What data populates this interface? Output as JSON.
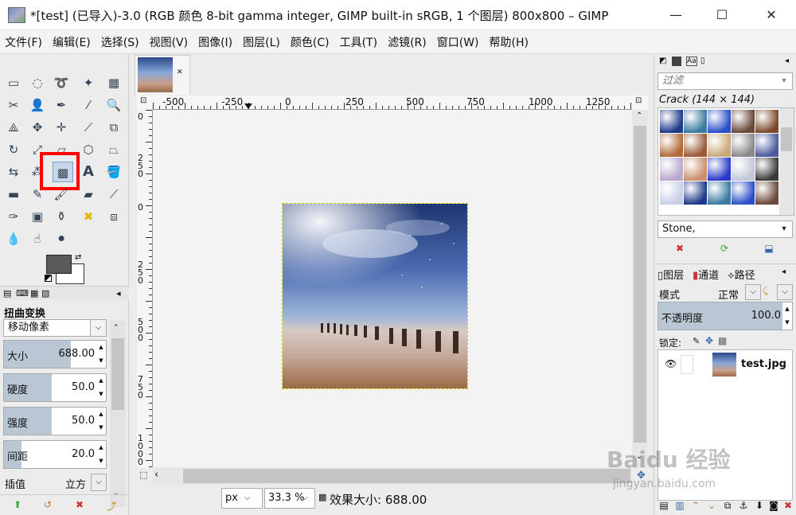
{
  "window": {
    "title": "*[test] (已导入)-3.0 (RGB 颜色 8-bit gamma integer, GIMP built-in sRGB, 1 个图层) 800x800 – GIMP",
    "minimize": "—",
    "maximize": "☐",
    "close": "✕"
  },
  "menu": [
    "文件(F)",
    "编辑(E)",
    "选择(S)",
    "视图(V)",
    "图像(I)",
    "图层(L)",
    "颜色(C)",
    "工具(T)",
    "滤镜(R)",
    "窗口(W)",
    "帮助(H)"
  ],
  "image_tab": {
    "close": "✕"
  },
  "ruler_h": [
    "-500",
    "-250",
    "0",
    "250",
    "500",
    "750",
    "1000",
    "1250"
  ],
  "ruler_v": [
    "0",
    "2\n5\n0",
    "0",
    "2\n5\n0",
    "5\n0\n0",
    "7\n5\n0",
    "1\n0\n0\n0"
  ],
  "tool_options": {
    "title": "扭曲变换",
    "mode": "移动像素",
    "size_label": "大小",
    "size_value": "688.00",
    "hardness_label": "硬度",
    "hardness_value": "50.0",
    "strength_label": "强度",
    "strength_value": "50.0",
    "spacing_label": "间距",
    "spacing_value": "20.0",
    "interp_label": "插值",
    "interp_value": "立方"
  },
  "status": {
    "unit": "px",
    "zoom": "33.3 %",
    "message": "效果大小: 688.00"
  },
  "patterns": {
    "filter_placeholder": "过滤",
    "current": "Crack (144 × 144)",
    "tag": "Stone,"
  },
  "layers": {
    "tabs": [
      "图层",
      "通道",
      "路径"
    ],
    "mode_label": "模式",
    "mode_value": "正常",
    "opacity_label": "不透明度",
    "opacity_value": "100.0",
    "lock_label": "锁定:",
    "layer_name": "test.jpg"
  },
  "watermark": {
    "brand": "Baidu 经验",
    "url": "jingyan.baidu.com"
  },
  "colors": {
    "foreground": "#5a5a5a",
    "background": "#ffffff",
    "highlight": "#ff0000"
  }
}
